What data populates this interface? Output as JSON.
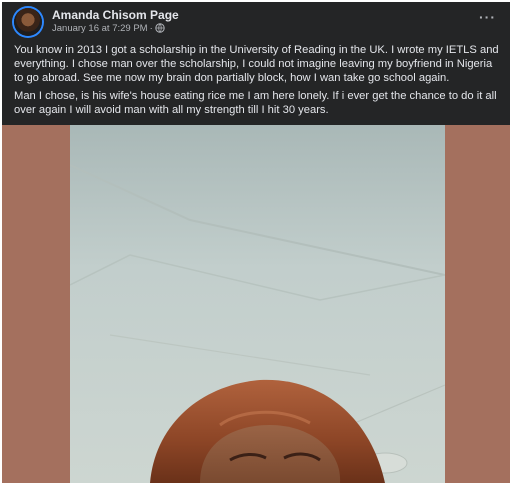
{
  "post": {
    "author": "Amanda Chisom Page",
    "date": "January 16 at 7:29 PM",
    "separator": "·",
    "more_label": "···",
    "paragraphs": [
      "You know in 2013 I got a scholarship in the University of Reading in the UK. I wrote my IETLS and everything. I chose man over the scholarship, I could not imagine leaving my boyfriend in Nigeria to go abroad. See me now my brain don partially block, how I wan take go school again.",
      "Man I chose, is his wife's house eating rice  me I am here lonely. If i ever get the chance to do it all over again  I will avoid man with all my strength till I hit 30 years."
    ]
  },
  "colors": {
    "card_bg": "#242526",
    "primary_text": "#e4e6eb",
    "secondary_text": "#b0b3b8",
    "photo_frame": "#a4705e",
    "avatar_ring": "#2d88ff"
  },
  "icons": {
    "privacy": "globe-icon",
    "options": "more-options-icon"
  }
}
